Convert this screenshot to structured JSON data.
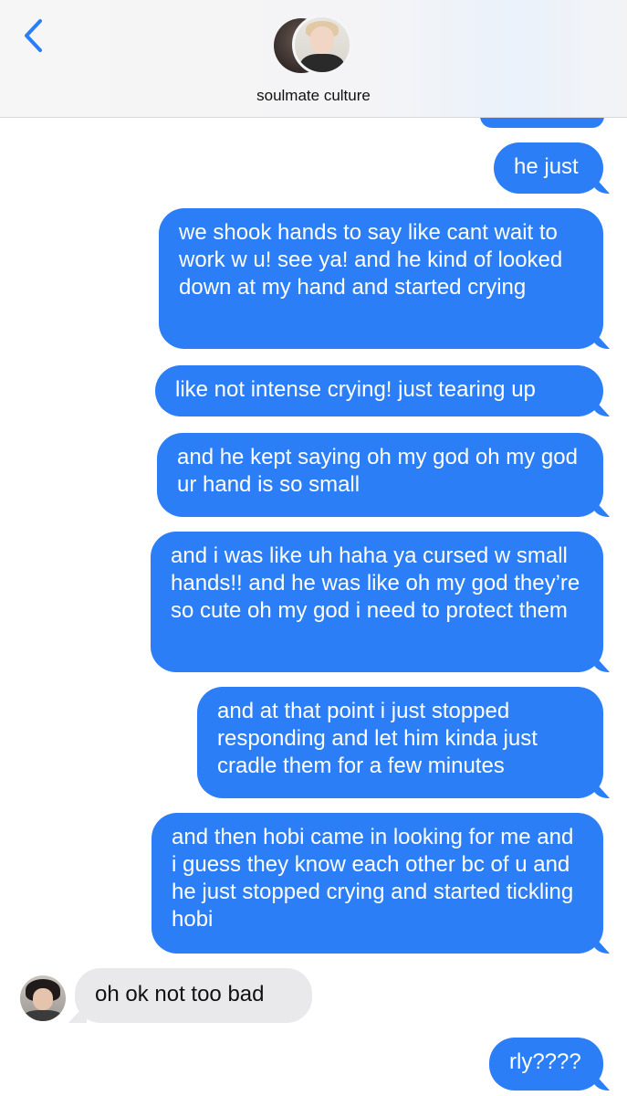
{
  "header": {
    "contact_name": "soulmate culture",
    "back_icon": "chevron-left-icon",
    "accent_color": "#2b7ef6"
  },
  "messages": [
    {
      "direction": "outgoing",
      "text": "he just"
    },
    {
      "direction": "outgoing",
      "text": "we shook hands to say like cant wait to work w u! see ya! and he kind of looked down at my hand and started crying"
    },
    {
      "direction": "outgoing",
      "text": "like not intense crying! just tearing up"
    },
    {
      "direction": "outgoing",
      "text": "and he kept saying oh my god oh my god ur hand is so small"
    },
    {
      "direction": "outgoing",
      "text": "and i was like uh haha ya cursed w small hands!! and he was like oh my god they’re so cute oh my god i need to protect them"
    },
    {
      "direction": "outgoing",
      "text": "and at that point i just stopped responding and let him kinda just cradle them for a few minutes"
    },
    {
      "direction": "outgoing",
      "text": "and then hobi came in looking for me and i guess they know each other bc of u and he just stopped crying and started tickling hobi"
    },
    {
      "direction": "incoming",
      "text": "oh ok not too bad"
    },
    {
      "direction": "outgoing",
      "text": "rly????"
    }
  ],
  "colors": {
    "outgoing_bubble": "#2b7ef6",
    "incoming_bubble": "#e9e9eb"
  }
}
